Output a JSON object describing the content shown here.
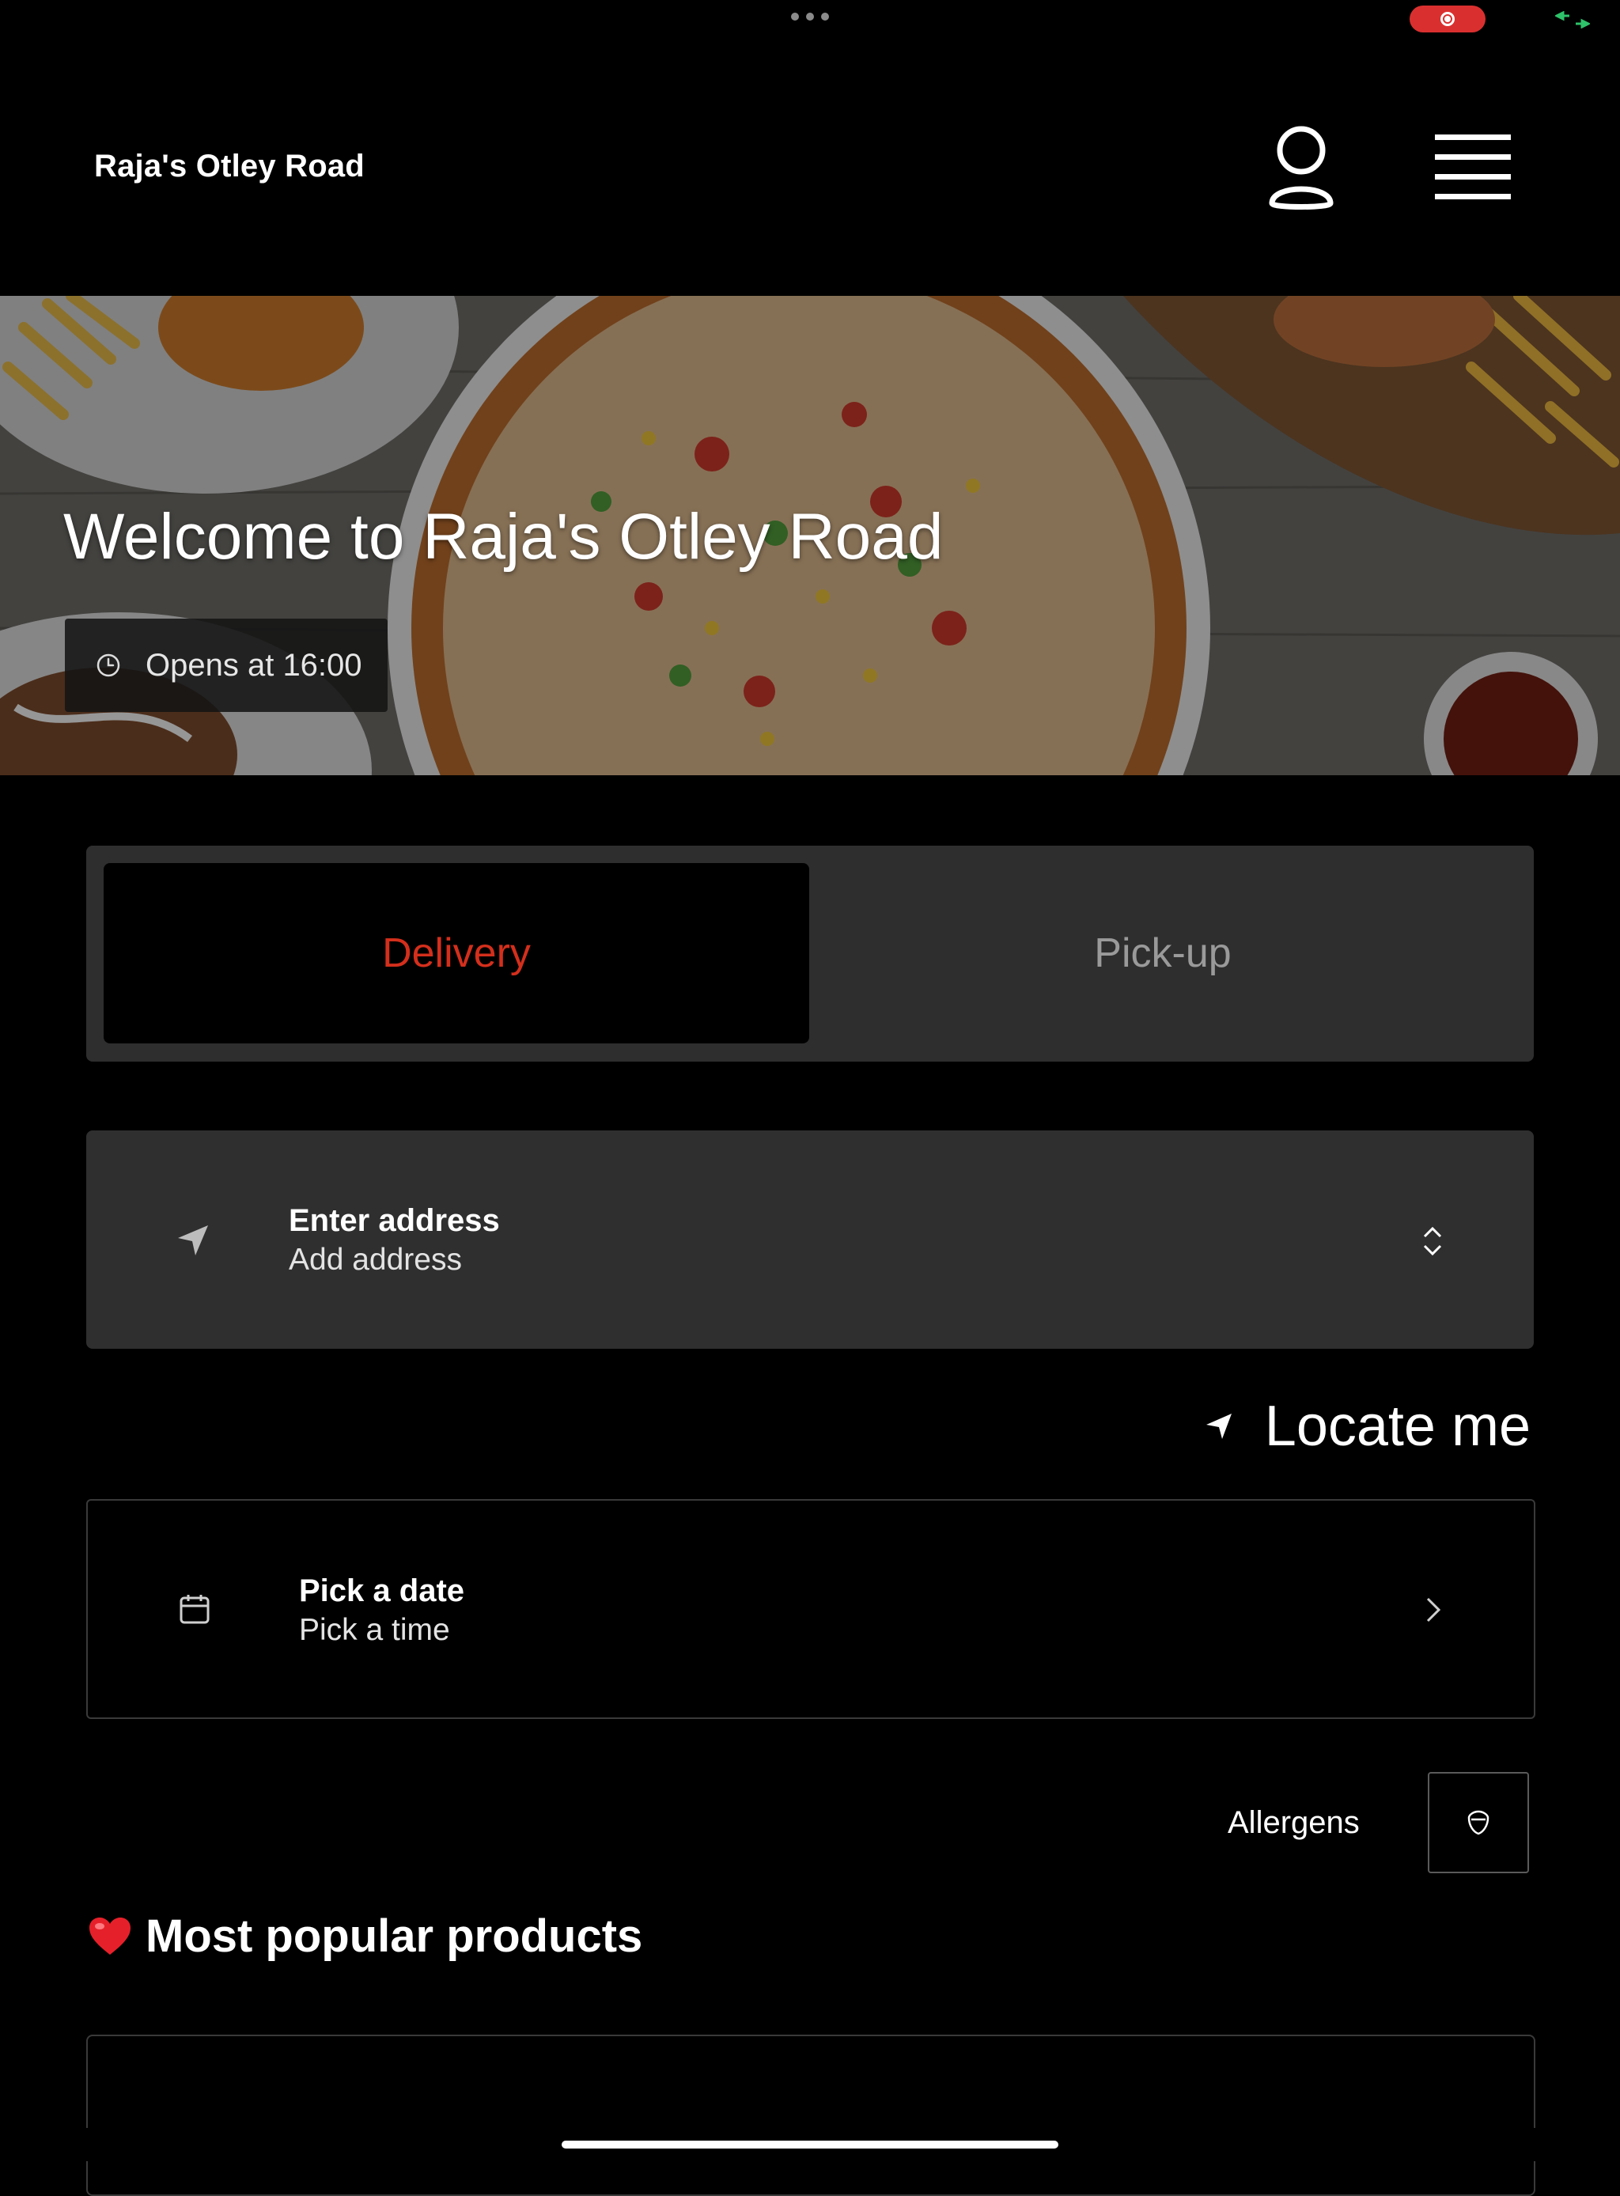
{
  "status_bar": {
    "icons": [
      "more-dots-icon",
      "screen-record-icon",
      "screen-mirror-icon"
    ]
  },
  "header": {
    "brand": "Raja's Otley Road",
    "icons": [
      "profile-icon",
      "hamburger-menu-icon"
    ]
  },
  "hero": {
    "title": "Welcome to Raja's Otley Road",
    "opens_text": "Opens at 16:00",
    "icon": "clock-icon"
  },
  "order_mode": {
    "options": [
      "Delivery",
      "Pick-up"
    ],
    "selected": "Delivery"
  },
  "address": {
    "title": "Enter address",
    "subtitle": "Add address",
    "icon": "location-arrow-icon"
  },
  "locate": {
    "label": "Locate me",
    "icon": "location-arrow-icon"
  },
  "schedule": {
    "title": "Pick a date",
    "subtitle": "Pick a time",
    "icon": "calendar-icon"
  },
  "allergens": {
    "label": "Allergens",
    "icon": "allergen-shield-icon"
  },
  "popular": {
    "title": "Most popular products",
    "icon": "heart-icon"
  },
  "colors": {
    "accent": "#d32f1c",
    "background": "#000000",
    "panel": "#2e2e2e"
  }
}
